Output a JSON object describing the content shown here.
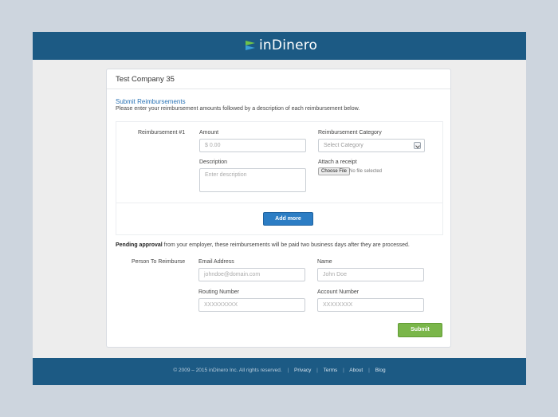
{
  "header": {
    "brand": "inDinero"
  },
  "card": {
    "company": "Test Company 35",
    "section_title": "Submit Reimbursements",
    "section_desc": "Please enter your reimbursement amounts followed by a description of each reimbursement below."
  },
  "reimbursement": {
    "row_label": "Reimbursement #1",
    "amount_label": "Amount",
    "amount_placeholder": "$ 0.00",
    "category_label": "Reimbursement Category",
    "category_selected": "Select Category",
    "description_label": "Description",
    "description_placeholder": "Enter description",
    "receipt_label": "Attach a receipt",
    "choose_file_label": "Choose File",
    "file_status": "No file selected",
    "add_more_label": "Add more"
  },
  "pending": {
    "bold": "Pending approval",
    "rest": " from your employer, these reimbursements will be paid two business days after they are processed."
  },
  "person": {
    "section_label": "Person To Reimburse",
    "email_label": "Email Address",
    "email_placeholder": "johndoe@domain.com",
    "name_label": "Name",
    "name_placeholder": "John Doe",
    "routing_label": "Routing Number",
    "routing_placeholder": "XXXXXXXXX",
    "account_label": "Account Number",
    "account_placeholder": "XXXXXXXX"
  },
  "submit_label": "Submit",
  "footer": {
    "copyright": "© 2009 – 2015 inDinero Inc. All rights reserved.",
    "links": [
      "Privacy",
      "Terms",
      "About",
      "Blog"
    ],
    "separator": "|"
  },
  "colors": {
    "header_bg": "#1c5a84",
    "accent_blue": "#2c7dc4",
    "submit_green": "#7ab64a",
    "link_blue": "#2a73b5",
    "logo_green": "#6fc24a"
  },
  "icons": [
    "indinero-logo-icon",
    "chevron-down-icon"
  ]
}
